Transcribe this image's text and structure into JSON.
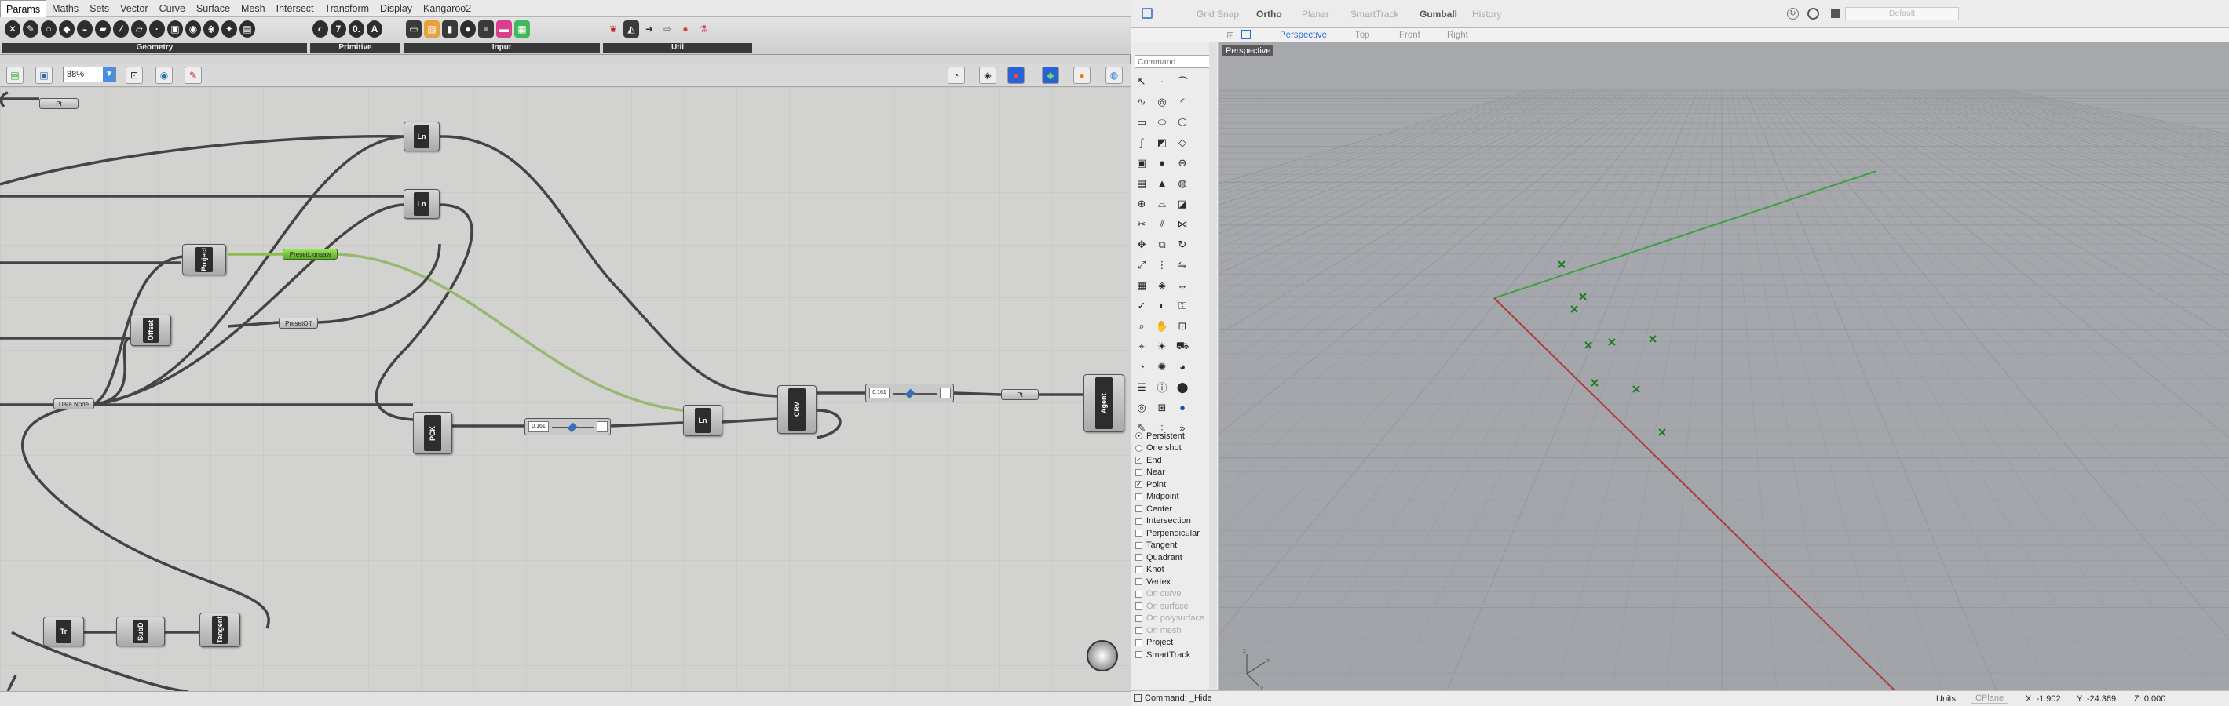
{
  "gh": {
    "menu": [
      "Params",
      "Maths",
      "Sets",
      "Vector",
      "Curve",
      "Surface",
      "Mesh",
      "Intersect",
      "Transform",
      "Display",
      "Kangaroo2"
    ],
    "groups": [
      "Geometry",
      "Primitive",
      "Input",
      "Util"
    ],
    "zoom": "88%",
    "nodes": {
      "pt": "Pt",
      "ln1": "Ln",
      "ln2": "Ln",
      "proj": "Project",
      "offset": "Offset",
      "preset_lionsaw": "PresetLionsaw",
      "preset_off": "PresetOff",
      "data_node": "Data Node",
      "pck": "PCK",
      "slider1": "0.161",
      "ln3": "Ln",
      "crv": "CRV",
      "slider2": "0.161",
      "pt2": "Pt",
      "agent": "Agent",
      "tr": "Tr",
      "subd": "SubD",
      "tangent": "Tangent"
    }
  },
  "rh": {
    "top_options": [
      "Grid Snap",
      "Ortho",
      "Planar",
      "SmartTrack",
      "Gumball",
      "History"
    ],
    "layer": "Default",
    "tabs": [
      "Perspective",
      "Top",
      "Front",
      "Right"
    ],
    "command_placeholder": "Command",
    "viewport_label": "Perspective",
    "snaps": [
      {
        "label": "Persistent",
        "state": "radio-on"
      },
      {
        "label": "One shot",
        "state": "radio-off"
      },
      {
        "label": "End",
        "state": "checked"
      },
      {
        "label": "Near",
        "state": "unchecked"
      },
      {
        "label": "Point",
        "state": "checked"
      },
      {
        "label": "Midpoint",
        "state": "unchecked"
      },
      {
        "label": "Center",
        "state": "unchecked"
      },
      {
        "label": "Intersection",
        "state": "unchecked"
      },
      {
        "label": "Perpendicular",
        "state": "unchecked"
      },
      {
        "label": "Tangent",
        "state": "unchecked"
      },
      {
        "label": "Quadrant",
        "state": "unchecked"
      },
      {
        "label": "Knot",
        "state": "unchecked"
      },
      {
        "label": "Vertex",
        "state": "unchecked"
      },
      {
        "label": "On curve",
        "state": "disabled"
      },
      {
        "label": "On surface",
        "state": "disabled"
      },
      {
        "label": "On polysurface",
        "state": "disabled"
      },
      {
        "label": "On mesh",
        "state": "disabled"
      },
      {
        "label": "Project",
        "state": "unchecked"
      },
      {
        "label": "SmartTrack",
        "state": "unchecked"
      }
    ],
    "status": {
      "command": "Command: _Hide",
      "units_label": "Units",
      "cplane": "CPlane",
      "x": "X: -1.902",
      "y": "Y: -24.369",
      "z": "Z: 0.000"
    }
  }
}
